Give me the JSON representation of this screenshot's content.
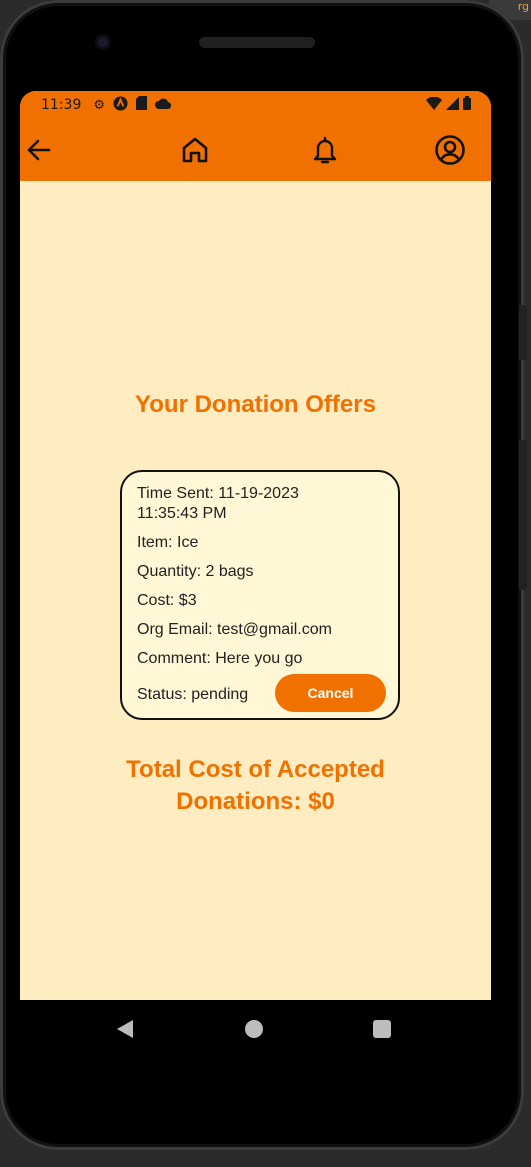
{
  "status_bar": {
    "time": "11:39",
    "icons": [
      "settings-icon",
      "app-icon",
      "sd-card-icon",
      "cloud-icon",
      "wifi-icon",
      "signal-icon",
      "battery-icon"
    ]
  },
  "app_bar": {
    "icons": [
      "back-arrow-icon",
      "home-icon",
      "bell-icon",
      "account-icon"
    ],
    "color": "#F07100"
  },
  "page": {
    "title": "Your Donation Offers",
    "total_line1": "Total Cost of Accepted",
    "total_line2": "Donations: $0",
    "background": "#FFECC0"
  },
  "offer": {
    "time_sent_line1": "Time Sent: 11-19-2023",
    "time_sent_line2": "11:35:43 PM",
    "item": "Item: Ice",
    "quantity": "Quantity: 2 bags",
    "cost": "Cost: $3",
    "org_email": "Org Email: test@gmail.com",
    "comment": "Comment: Here you go",
    "status": "Status: pending",
    "cancel_label": "Cancel"
  },
  "corner_text": "rg"
}
